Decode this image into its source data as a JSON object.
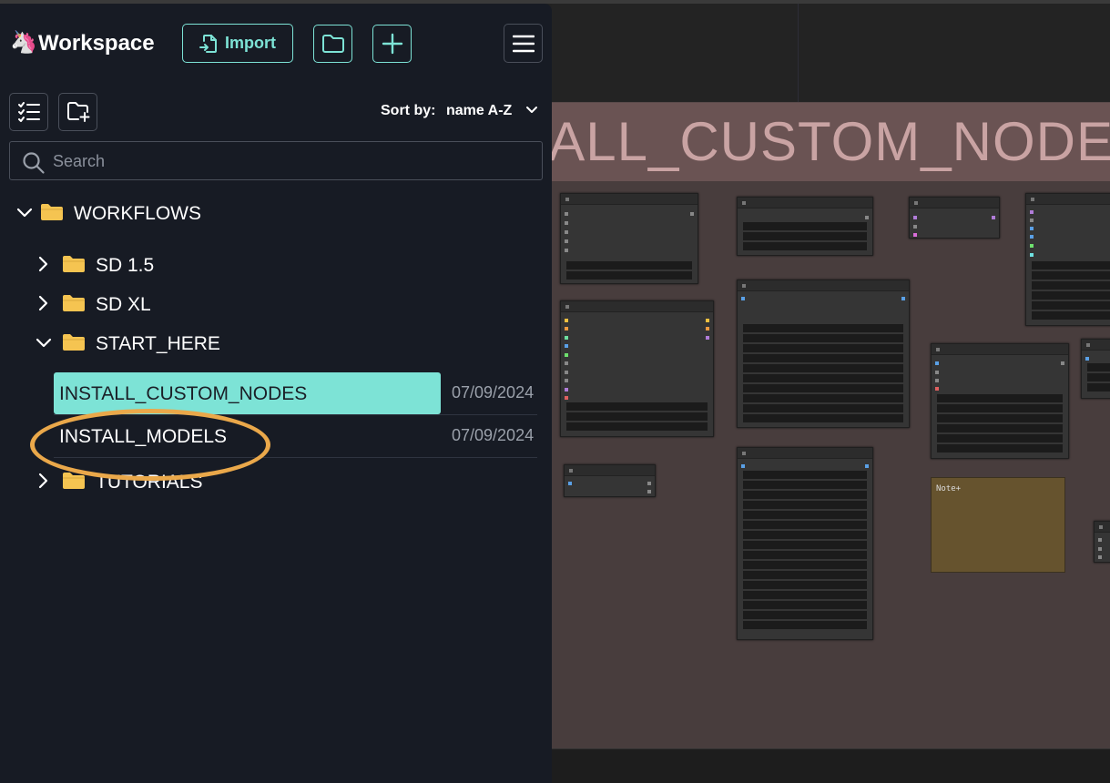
{
  "sidebar": {
    "logo": "🦄",
    "title": "Workspace",
    "import_label": "Import",
    "sort_label": "Sort by:",
    "sort_value": "name A-Z",
    "search_placeholder": "Search",
    "tree": {
      "root": "WORKFLOWS",
      "folders": {
        "sd15": "SD 1.5",
        "sdxl": "SD XL",
        "start_here": "START_HERE",
        "tutorials": "TUTORIALS"
      },
      "files": [
        {
          "name": "INSTALL_CUSTOM_NODES",
          "date": "07/09/2024",
          "selected": true
        },
        {
          "name": "INSTALL_MODELS",
          "date": "07/09/2024",
          "selected": false
        }
      ]
    }
  },
  "canvas": {
    "group_title": "INSTALL_CUSTOM_NODES",
    "note_label": "Note+"
  },
  "colors": {
    "accent": "#7de3d6",
    "sidebar_bg": "#171b24",
    "annotation": "#eaa84a",
    "group_bg": "#483d3d",
    "note_bg": "#66532e"
  },
  "icons": [
    "unicorn-icon",
    "file-import-icon",
    "folder-icon",
    "plus-icon",
    "hamburger-menu-icon",
    "checklist-icon",
    "folder-plus-icon",
    "chevron-down-icon",
    "search-icon",
    "chevron-right-icon",
    "folder-icon"
  ]
}
